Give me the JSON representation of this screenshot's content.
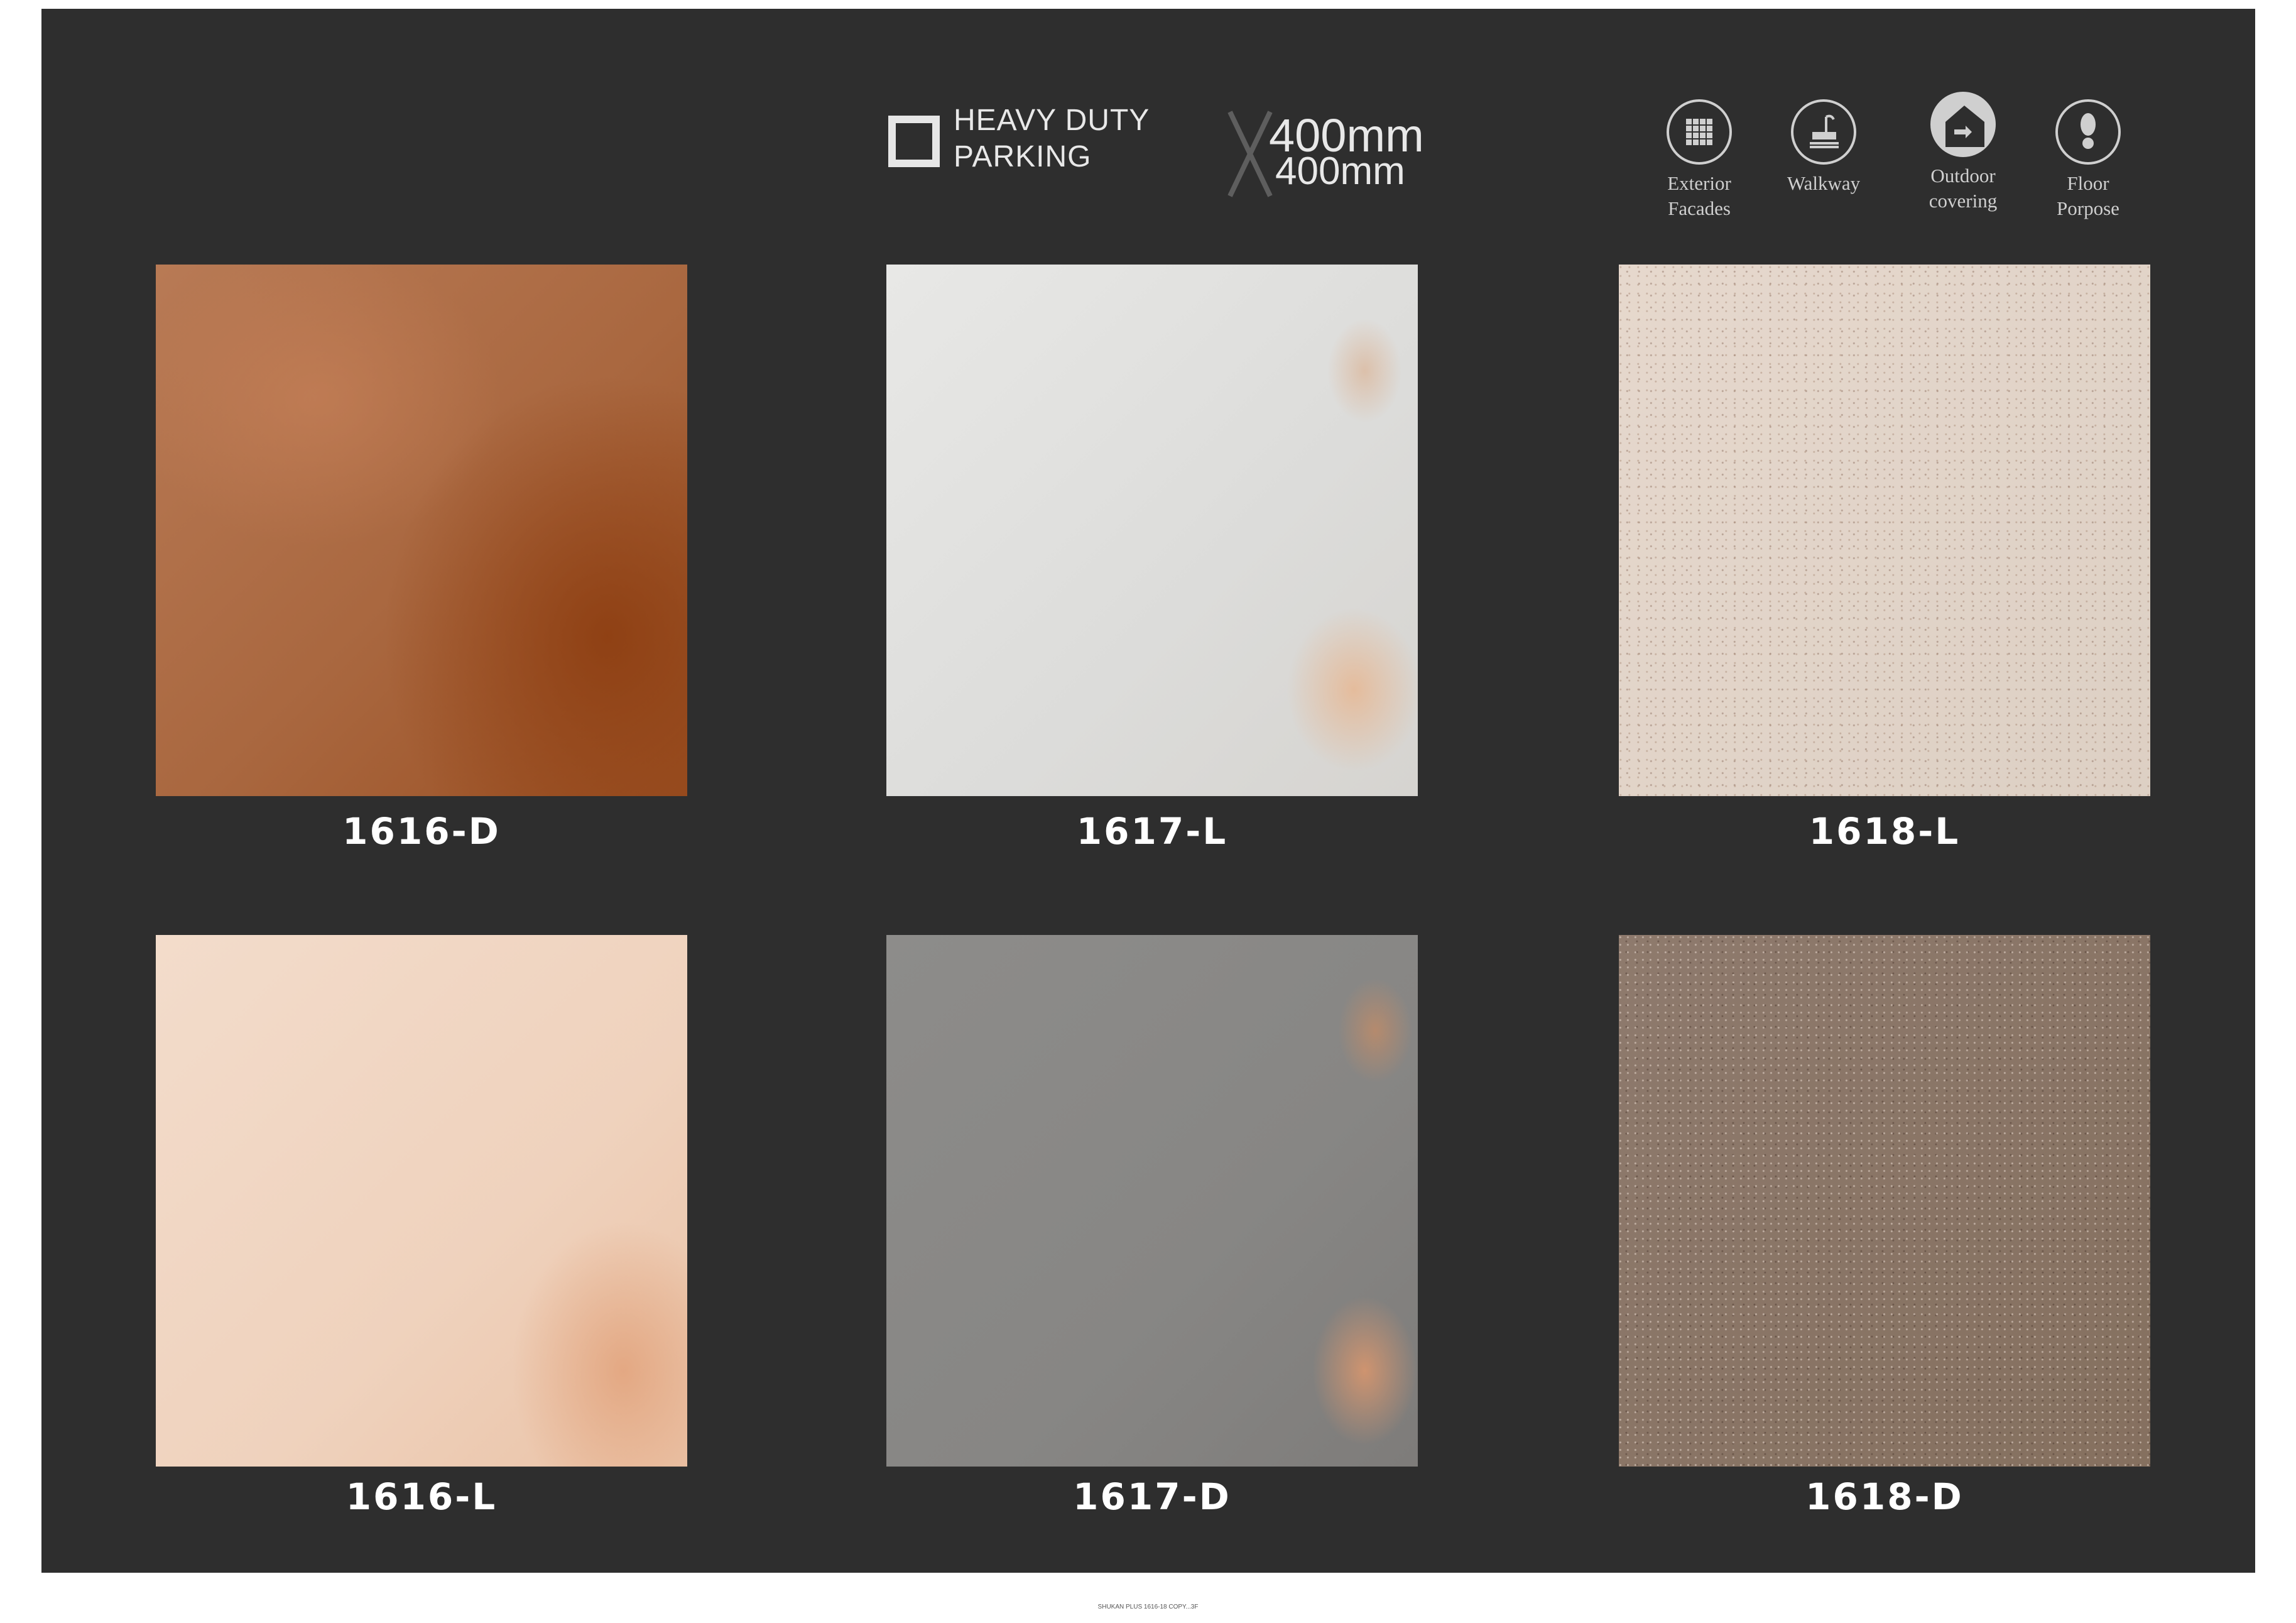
{
  "header": {
    "parking_line1": "HEAVY DUTY",
    "parking_line2": "PARKING",
    "size_line1": "400mm",
    "size_line2": "400mm"
  },
  "usage_icons": [
    {
      "icon": "grid-icon",
      "label_line1": "Exterior",
      "label_line2": "Facades"
    },
    {
      "icon": "walkway-icon",
      "label_line1": "Walkway",
      "label_line2": ""
    },
    {
      "icon": "house-icon",
      "label_line1": "Outdoor",
      "label_line2": "covering"
    },
    {
      "icon": "footprint-icon",
      "label_line1": "Floor",
      "label_line2": "Porpose"
    }
  ],
  "tiles": [
    {
      "code": "1616-D",
      "color": "#a9673f"
    },
    {
      "code": "1617-L",
      "color": "#dcdcda"
    },
    {
      "code": "1618-L",
      "color": "#e2d5ca"
    },
    {
      "code": "1616-L",
      "color": "#efd2bd"
    },
    {
      "code": "1617-D",
      "color": "#878684"
    },
    {
      "code": "1618-D",
      "color": "#85705f"
    }
  ],
  "footer_note": "SHUKAN PLUS 1616-18 COPY...3F"
}
